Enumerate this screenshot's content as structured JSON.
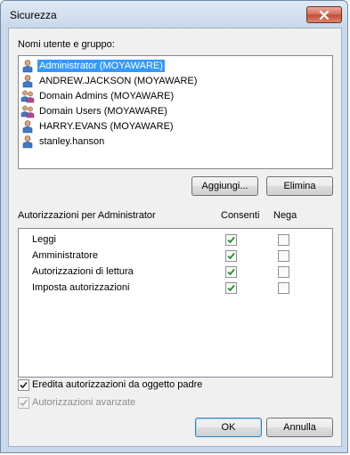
{
  "window": {
    "title": "Sicurezza"
  },
  "users_section": {
    "label": "Nomi utente e gruppo:",
    "items": [
      {
        "label": "Administrator (MOYAWARE)",
        "icon": "user-icon",
        "selected": true
      },
      {
        "label": "ANDREW.JACKSON (MOYAWARE)",
        "icon": "user-icon",
        "selected": false
      },
      {
        "label": "Domain Admins (MOYAWARE)",
        "icon": "group-icon",
        "selected": false
      },
      {
        "label": "Domain Users (MOYAWARE)",
        "icon": "group-icon",
        "selected": false
      },
      {
        "label": "HARRY.EVANS (MOYAWARE)",
        "icon": "user-icon",
        "selected": false
      },
      {
        "label": "stanley.hanson",
        "icon": "user-icon",
        "selected": false
      }
    ],
    "add_button": "Aggiungi...",
    "remove_button": "Elimina"
  },
  "permissions": {
    "label": "Autorizzazioni per Administrator",
    "col_allow": "Consenti",
    "col_deny": "Nega",
    "rows": [
      {
        "name": "Leggi",
        "allow": true,
        "deny": false
      },
      {
        "name": "Amministratore",
        "allow": true,
        "deny": false
      },
      {
        "name": "Autorizzazioni di lettura",
        "allow": true,
        "deny": false
      },
      {
        "name": "Imposta autorizzazioni",
        "allow": true,
        "deny": false
      }
    ]
  },
  "inherit": {
    "label": "Eredita autorizzazioni da oggetto padre",
    "checked": true
  },
  "advanced": {
    "label": "Autorizzazioni avanzate",
    "checked": true,
    "enabled": false
  },
  "footer": {
    "ok": "OK",
    "cancel": "Annulla"
  },
  "colors": {
    "selection": "#3399ff",
    "check": "#2a8a2a"
  }
}
